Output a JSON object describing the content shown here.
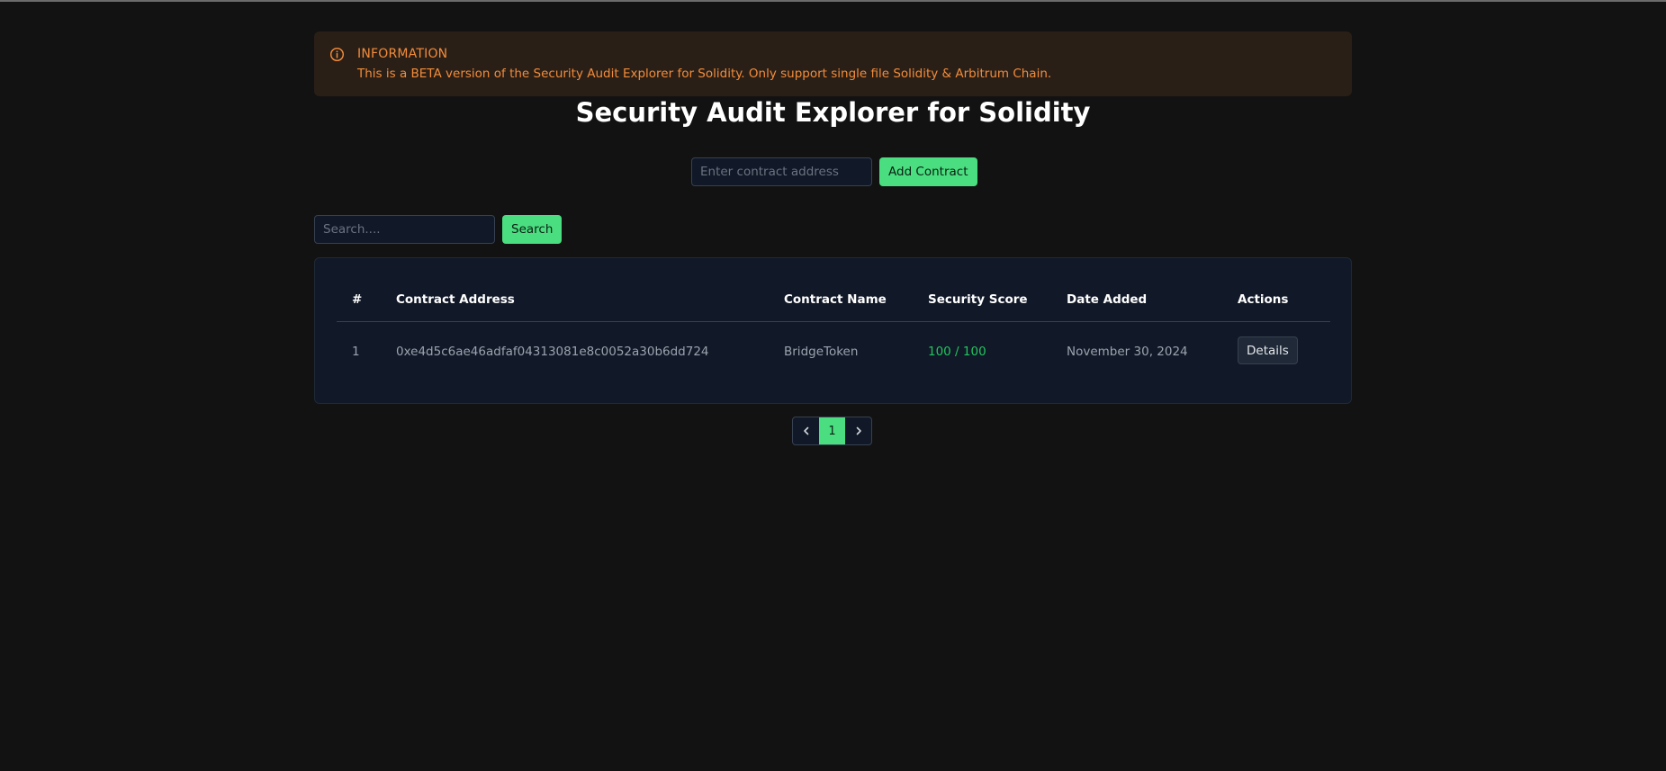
{
  "alert": {
    "title": "INFORMATION",
    "message": "This is a BETA version of the Security Audit Explorer for Solidity. Only support single file Solidity & Arbitrum Chain.",
    "icon": "info-icon",
    "color": "#f28c3a"
  },
  "page": {
    "title": "Security Audit Explorer for Solidity"
  },
  "add_contract": {
    "placeholder": "Enter contract address",
    "value": "",
    "button_label": "Add Contract"
  },
  "search": {
    "placeholder": "Search....",
    "value": "",
    "button_label": "Search"
  },
  "table": {
    "headers": {
      "index": "#",
      "address": "Contract Address",
      "name": "Contract Name",
      "score": "Security Score",
      "date": "Date Added",
      "actions": "Actions"
    },
    "rows": [
      {
        "index": "1",
        "address": "0xe4d5c6ae46adfaf04313081e8c0052a30b6dd724",
        "name": "BridgeToken",
        "score": "100 / 100",
        "date": "November 30, 2024",
        "action_label": "Details"
      }
    ]
  },
  "pagination": {
    "current_page": "1",
    "prev_icon": "chevron-left-icon",
    "next_icon": "chevron-right-icon"
  },
  "colors": {
    "background": "#121212",
    "accent": "#4ade80",
    "score": "#22c55e",
    "card": "#111827"
  }
}
